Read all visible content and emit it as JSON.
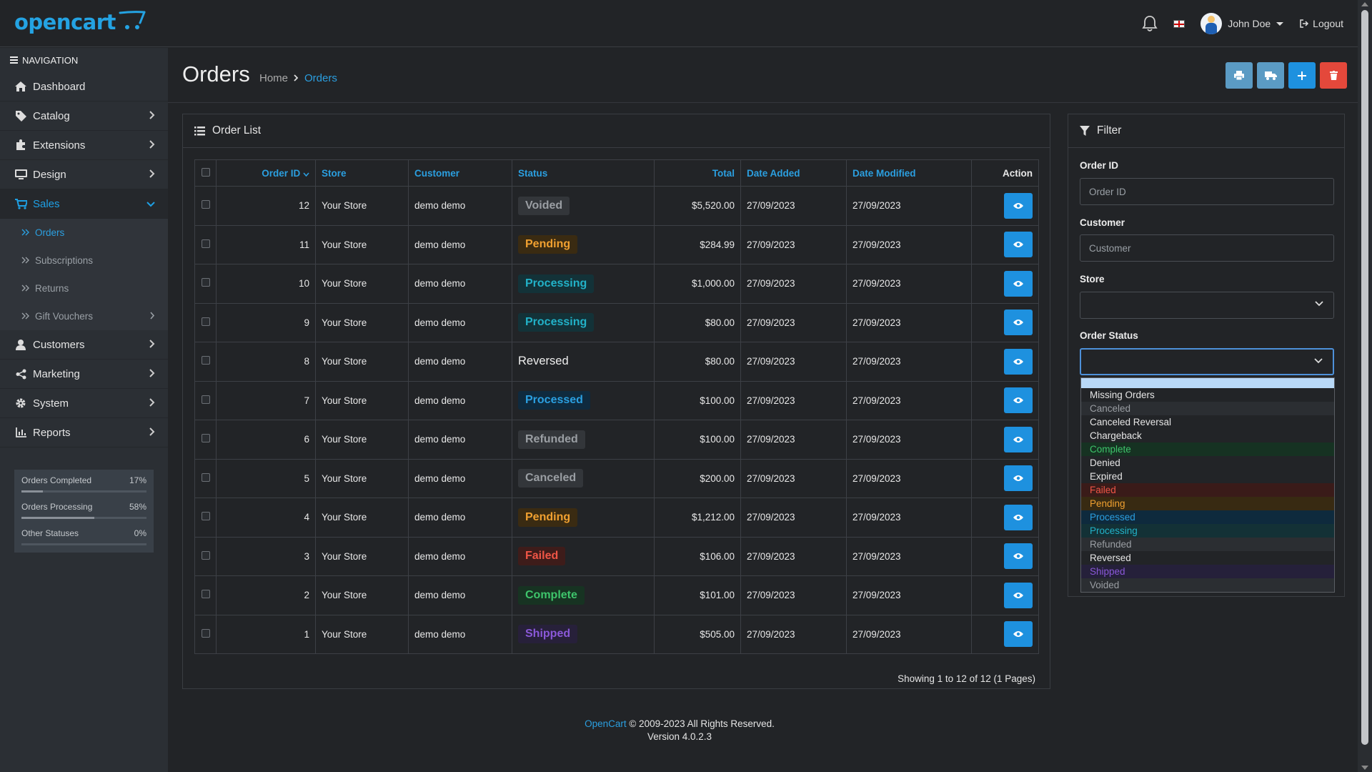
{
  "header": {
    "logo_text": "opencart",
    "user_name": "John Doe",
    "logout_label": "Logout"
  },
  "sidebar": {
    "nav_heading": "NAVIGATION",
    "items": [
      {
        "label": "Dashboard",
        "icon": "home-icon"
      },
      {
        "label": "Catalog",
        "icon": "tag-icon"
      },
      {
        "label": "Extensions",
        "icon": "puzzle-icon"
      },
      {
        "label": "Design",
        "icon": "monitor-icon"
      },
      {
        "label": "Sales",
        "icon": "cart-icon"
      },
      {
        "label": "Customers",
        "icon": "user-icon"
      },
      {
        "label": "Marketing",
        "icon": "share-icon"
      },
      {
        "label": "System",
        "icon": "gear-icon"
      },
      {
        "label": "Reports",
        "icon": "bar-chart-icon"
      }
    ],
    "sales_sub": [
      {
        "label": "Orders"
      },
      {
        "label": "Subscriptions"
      },
      {
        "label": "Returns"
      },
      {
        "label": "Gift Vouchers"
      }
    ],
    "stats": [
      {
        "label": "Orders Completed",
        "value": "17%",
        "fraction": 0.17
      },
      {
        "label": "Orders Processing",
        "value": "58%",
        "fraction": 0.58
      },
      {
        "label": "Other Statuses",
        "value": "0%",
        "fraction": 0.0
      }
    ]
  },
  "page": {
    "title": "Orders",
    "breadcrumb_home": "Home",
    "breadcrumb_current": "Orders"
  },
  "order_list": {
    "title": "Order List",
    "columns": {
      "order_id": "Order ID",
      "store": "Store",
      "customer": "Customer",
      "status": "Status",
      "total": "Total",
      "date_added": "Date Added",
      "date_modified": "Date Modified",
      "action": "Action"
    },
    "rows": [
      {
        "id": "12",
        "store": "Your Store",
        "customer": "demo demo",
        "status": "Voided",
        "total": "$5,520.00",
        "added": "27/09/2023",
        "modified": "27/09/2023"
      },
      {
        "id": "11",
        "store": "Your Store",
        "customer": "demo demo",
        "status": "Pending",
        "total": "$284.99",
        "added": "27/09/2023",
        "modified": "27/09/2023"
      },
      {
        "id": "10",
        "store": "Your Store",
        "customer": "demo demo",
        "status": "Processing",
        "total": "$1,000.00",
        "added": "27/09/2023",
        "modified": "27/09/2023"
      },
      {
        "id": "9",
        "store": "Your Store",
        "customer": "demo demo",
        "status": "Processing",
        "total": "$80.00",
        "added": "27/09/2023",
        "modified": "27/09/2023"
      },
      {
        "id": "8",
        "store": "Your Store",
        "customer": "demo demo",
        "status": "Reversed",
        "total": "$80.00",
        "added": "27/09/2023",
        "modified": "27/09/2023"
      },
      {
        "id": "7",
        "store": "Your Store",
        "customer": "demo demo",
        "status": "Processed",
        "total": "$100.00",
        "added": "27/09/2023",
        "modified": "27/09/2023"
      },
      {
        "id": "6",
        "store": "Your Store",
        "customer": "demo demo",
        "status": "Refunded",
        "total": "$100.00",
        "added": "27/09/2023",
        "modified": "27/09/2023"
      },
      {
        "id": "5",
        "store": "Your Store",
        "customer": "demo demo",
        "status": "Canceled",
        "total": "$200.00",
        "added": "27/09/2023",
        "modified": "27/09/2023"
      },
      {
        "id": "4",
        "store": "Your Store",
        "customer": "demo demo",
        "status": "Pending",
        "total": "$1,212.00",
        "added": "27/09/2023",
        "modified": "27/09/2023"
      },
      {
        "id": "3",
        "store": "Your Store",
        "customer": "demo demo",
        "status": "Failed",
        "total": "$106.00",
        "added": "27/09/2023",
        "modified": "27/09/2023"
      },
      {
        "id": "2",
        "store": "Your Store",
        "customer": "demo demo",
        "status": "Complete",
        "total": "$101.00",
        "added": "27/09/2023",
        "modified": "27/09/2023"
      },
      {
        "id": "1",
        "store": "Your Store",
        "customer": "demo demo",
        "status": "Shipped",
        "total": "$505.00",
        "added": "27/09/2023",
        "modified": "27/09/2023"
      }
    ],
    "showing": "Showing 1 to 12 of 12 (1 Pages)"
  },
  "status_styles": {
    "Voided": {
      "fg": "#9a9ea3",
      "bg": "#33363a"
    },
    "Pending": {
      "fg": "#f0a030",
      "bg": "#3a2b12"
    },
    "Processing": {
      "fg": "#22b2c8",
      "bg": "#133238"
    },
    "Reversed": {
      "fg": "#eeeeee",
      "bg": "transparent"
    },
    "Processed": {
      "fg": "#2b9fe0",
      "bg": "#0f2a3e"
    },
    "Refunded": {
      "fg": "#9a9ea3",
      "bg": "#33363a"
    },
    "Canceled": {
      "fg": "#9a9ea3",
      "bg": "#33363a"
    },
    "Failed": {
      "fg": "#ef5546",
      "bg": "#3e1c1a"
    },
    "Complete": {
      "fg": "#3ec46b",
      "bg": "#173322"
    },
    "Shipped": {
      "fg": "#8a58d8",
      "bg": "#27203a"
    }
  },
  "filter": {
    "title": "Filter",
    "order_id_label": "Order ID",
    "order_id_placeholder": "Order ID",
    "customer_label": "Customer",
    "customer_placeholder": "Customer",
    "store_label": "Store",
    "store_value": "",
    "order_status_label": "Order Status",
    "order_status_value": "",
    "status_options": [
      {
        "label": "",
        "fg": "#222222",
        "bg": "#b8d8f7"
      },
      {
        "label": "Missing Orders",
        "fg": "#e5e5e5",
        "bg": "#222427"
      },
      {
        "label": "Canceled",
        "fg": "#9a9ea3",
        "bg": "#2b2e32"
      },
      {
        "label": "Canceled Reversal",
        "fg": "#e5e5e5",
        "bg": "#222427"
      },
      {
        "label": "Chargeback",
        "fg": "#e5e5e5",
        "bg": "#222427"
      },
      {
        "label": "Complete",
        "fg": "#3ec46b",
        "bg": "#163222"
      },
      {
        "label": "Denied",
        "fg": "#e5e5e5",
        "bg": "#222427"
      },
      {
        "label": "Expired",
        "fg": "#e5e5e5",
        "bg": "#222427"
      },
      {
        "label": "Failed",
        "fg": "#ef5546",
        "bg": "#3a1b19"
      },
      {
        "label": "Pending",
        "fg": "#f0a030",
        "bg": "#382a12"
      },
      {
        "label": "Processed",
        "fg": "#2b9fe0",
        "bg": "#0e2a3d"
      },
      {
        "label": "Processing",
        "fg": "#22b2c8",
        "bg": "#133136"
      },
      {
        "label": "Refunded",
        "fg": "#9a9ea3",
        "bg": "#2b2e32"
      },
      {
        "label": "Reversed",
        "fg": "#e5e5e5",
        "bg": "#222427"
      },
      {
        "label": "Shipped",
        "fg": "#8a58d8",
        "bg": "#25203a"
      },
      {
        "label": "Voided",
        "fg": "#9a9ea3",
        "bg": "#2b2e32"
      }
    ]
  },
  "footer": {
    "brand_link": "OpenCart",
    "copyright": "© 2009-2023 All Rights Reserved.",
    "version": "Version 4.0.2.3"
  }
}
